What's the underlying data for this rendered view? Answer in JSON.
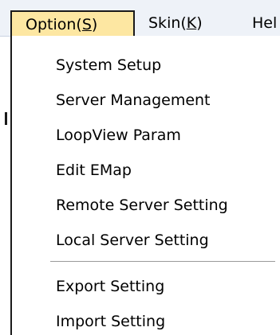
{
  "menubar": {
    "option": {
      "label": "Option(",
      "mnemonic": "S",
      "suffix": ")"
    },
    "skin": {
      "label": "Skin(",
      "mnemonic": "K",
      "suffix": ")"
    },
    "help": {
      "label": "Hel"
    }
  },
  "option_menu": {
    "items": [
      "System Setup",
      "Server Management",
      "LoopView Param",
      "Edit EMap",
      "Remote Server Setting",
      "Local Server Setting",
      "Export Setting",
      "Import Setting"
    ]
  },
  "colors": {
    "menubar_bg": "#eef2f8",
    "open_menu_highlight": "#fde7a2",
    "menu_bg": "#ffffff",
    "text": "#000000"
  }
}
